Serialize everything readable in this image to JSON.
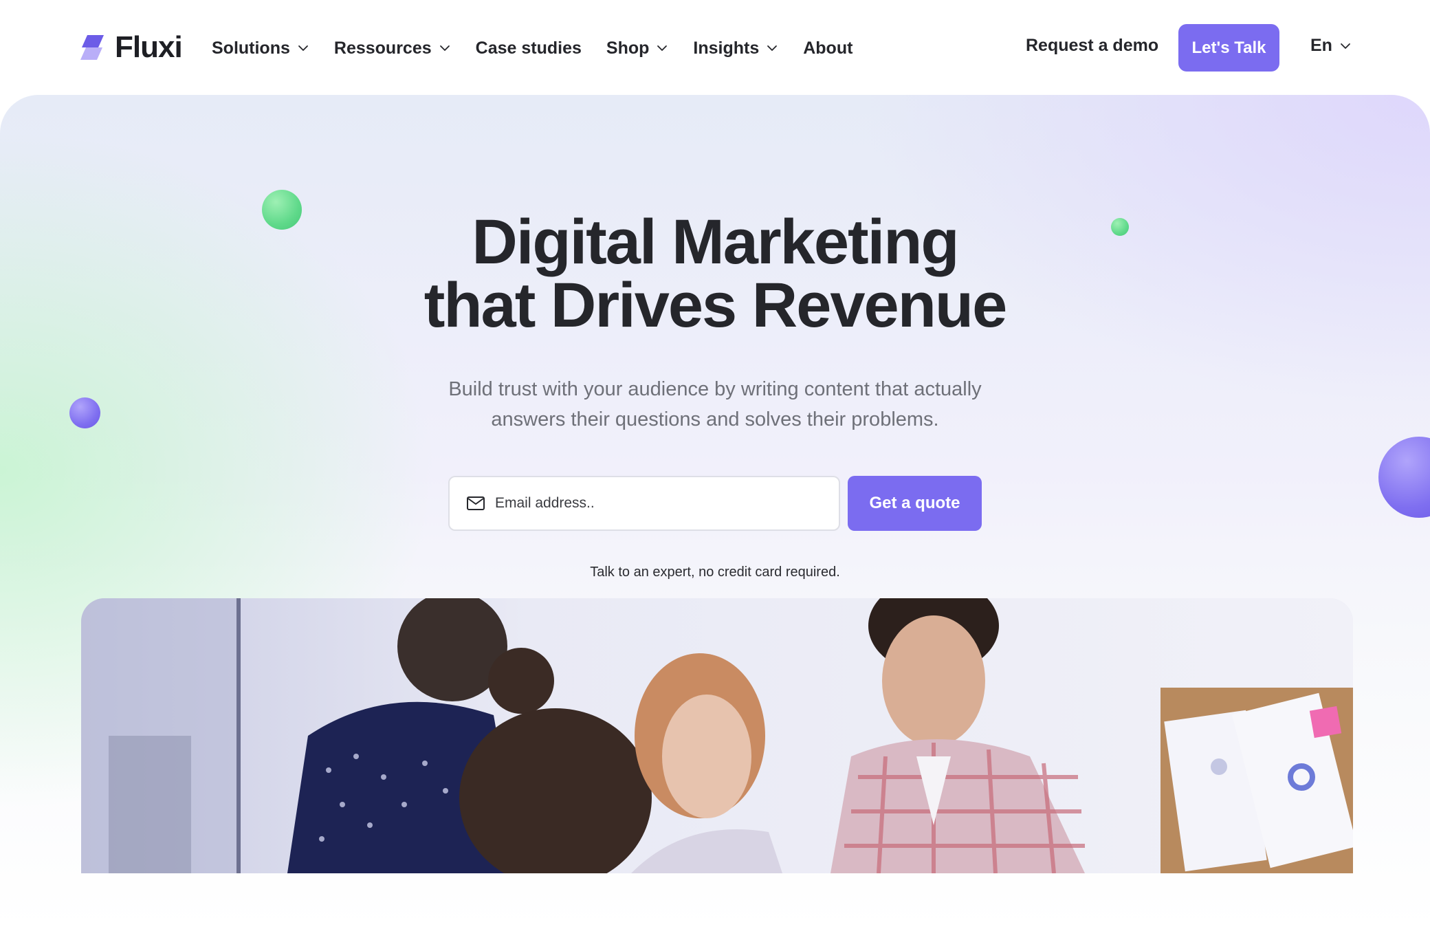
{
  "brand": {
    "name": "Fluxi",
    "logo_icon": "fluxi-logo-icon",
    "accent": "#7b6cf0"
  },
  "nav": {
    "items": [
      {
        "label": "Solutions",
        "has_dropdown": true
      },
      {
        "label": "Ressources",
        "has_dropdown": true
      },
      {
        "label": "Case studies",
        "has_dropdown": false
      },
      {
        "label": "Shop",
        "has_dropdown": true
      },
      {
        "label": "Insights",
        "has_dropdown": true
      },
      {
        "label": "About",
        "has_dropdown": false
      }
    ],
    "request_demo": "Request a demo",
    "cta": "Let's Talk",
    "language": "En"
  },
  "hero": {
    "title_line1": "Digital Marketing",
    "title_line2": "that Drives Revenue",
    "subtitle": "Build trust with your audience by writing content that actually answers their questions and solves their problems.",
    "email_placeholder": "Email address..",
    "email_icon": "mail-icon",
    "submit": "Get a quote",
    "note": "Talk to an expert, no credit card required."
  },
  "colors": {
    "accent": "#7b6cf0",
    "green_dot": "#5fd98a",
    "purple_dot": "#7f6ff0",
    "text": "#25262b",
    "muted": "#6e7078"
  }
}
